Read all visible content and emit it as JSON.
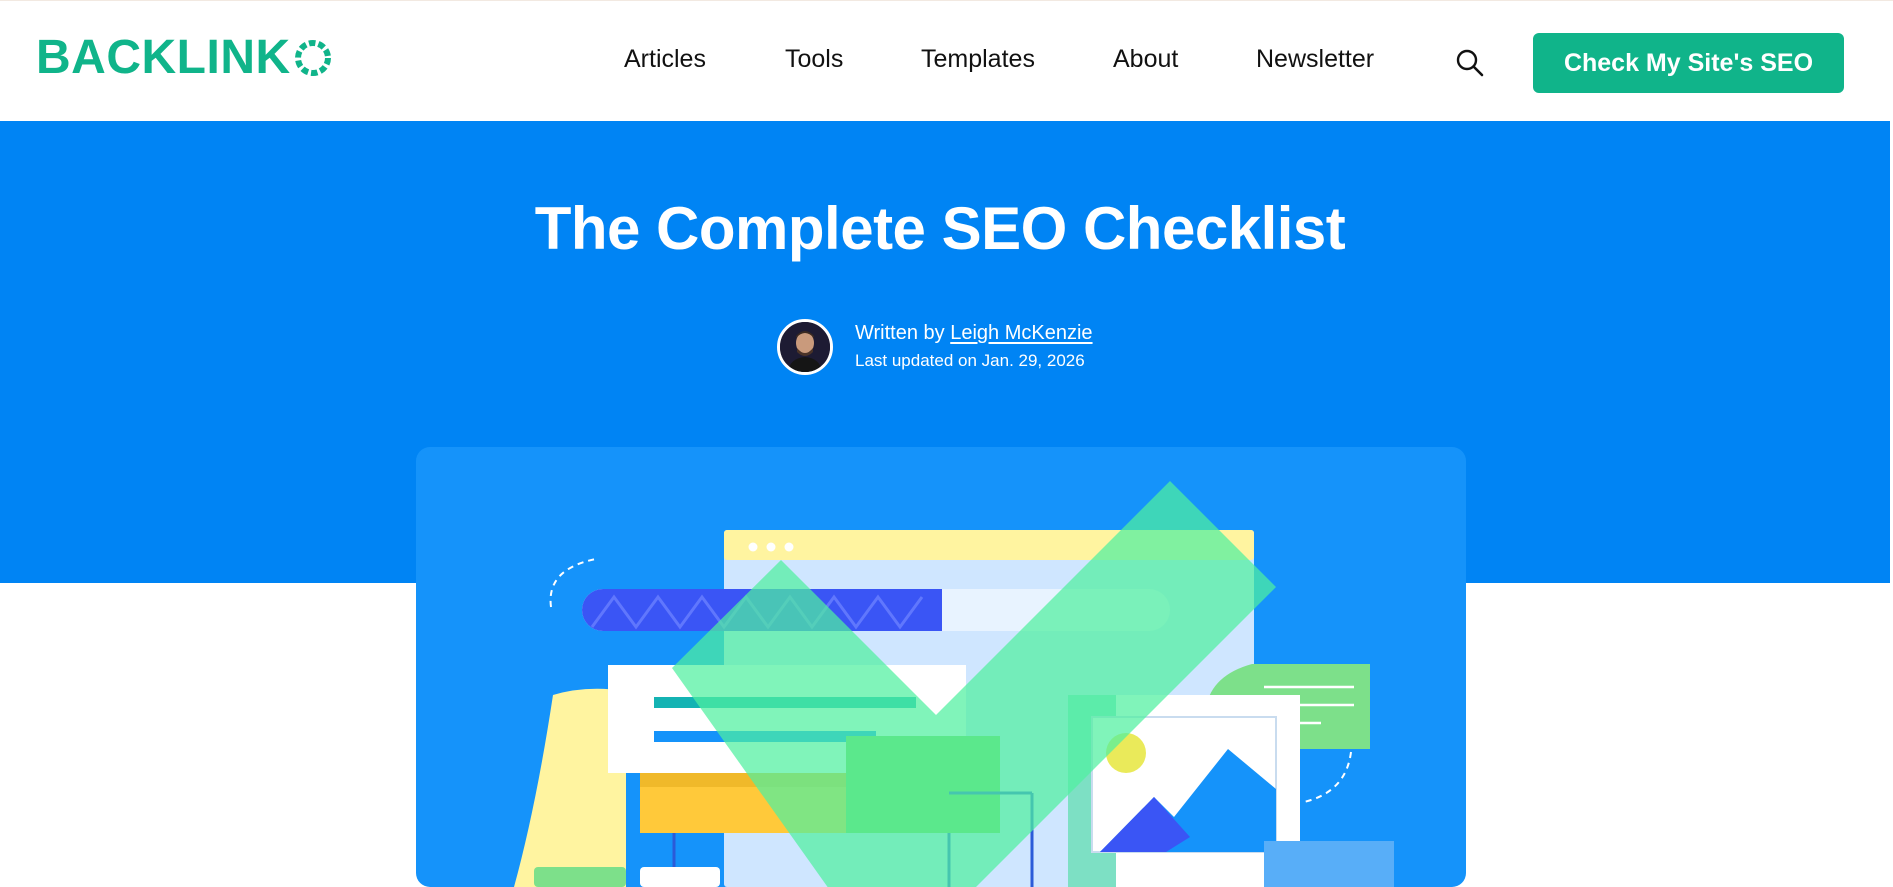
{
  "header": {
    "logo_text": "BACKLINK",
    "nav": [
      {
        "label": "Articles"
      },
      {
        "label": "Tools"
      },
      {
        "label": "Templates"
      },
      {
        "label": "About"
      },
      {
        "label": "Newsletter"
      }
    ],
    "search_icon": "search-icon",
    "cta_label": "Check My Site's SEO"
  },
  "hero": {
    "title": "The Complete SEO Checklist",
    "written_by_prefix": "Written by",
    "author_name": "Leigh McKenzie",
    "last_updated": "Last updated on Jan. 29, 2026"
  },
  "colors": {
    "brand_green": "#10b48a",
    "hero_blue": "#0084f4",
    "card_blue": "#1593fa",
    "text_dark": "#111111"
  }
}
